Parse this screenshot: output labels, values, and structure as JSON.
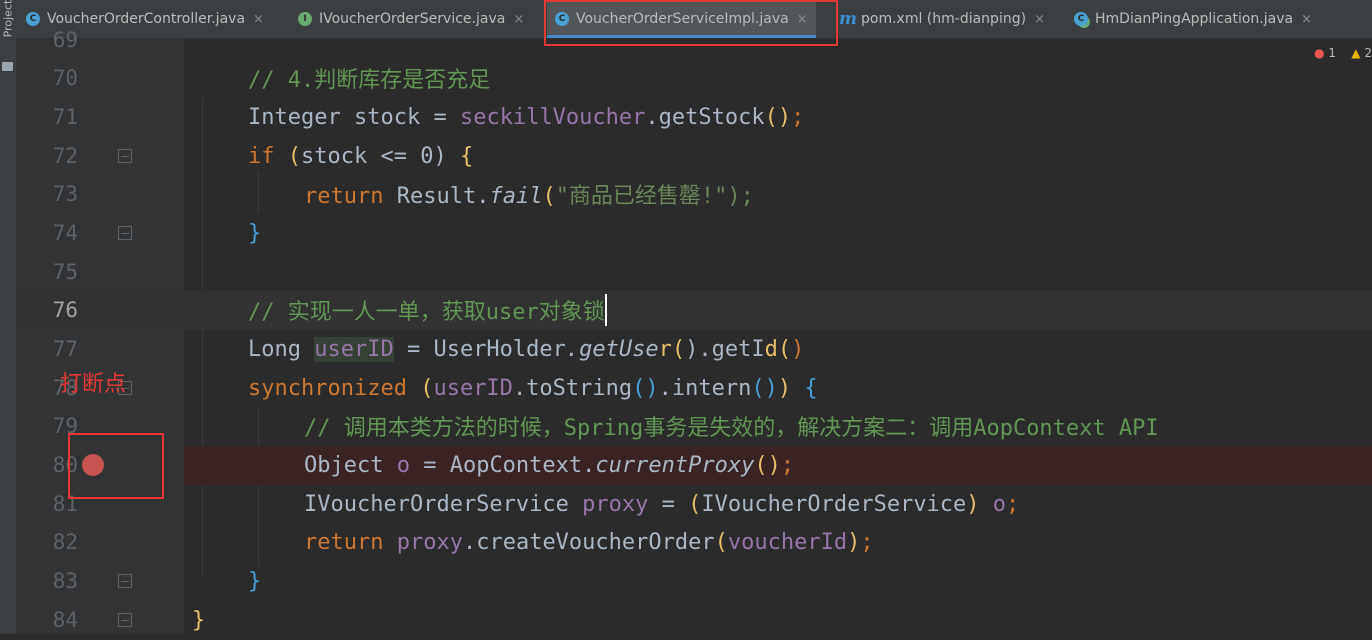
{
  "tabs": [
    {
      "label": "VoucherOrderController.java",
      "icon": "class-icon",
      "active": false
    },
    {
      "label": "IVoucherOrderService.java",
      "icon": "interface-icon",
      "active": false
    },
    {
      "label": "VoucherOrderServiceImpl.java",
      "icon": "class-icon",
      "active": true
    },
    {
      "label": "pom.xml (hm-dianping)",
      "icon": "maven-icon",
      "active": false
    },
    {
      "label": "HmDianPingApplication.java",
      "icon": "app-class-icon",
      "active": false
    }
  ],
  "close_glyph": "×",
  "side_panel": {
    "label": "Project"
  },
  "status": {
    "errors": "1",
    "warnings": "2"
  },
  "annotation": {
    "label": "打断点",
    "color": "#e53935"
  },
  "lines": [
    {
      "n": "69",
      "code": ""
    },
    {
      "n": "70",
      "code": "// 4.判断库存是否充足"
    },
    {
      "n": "71",
      "code": "Integer stock = seckillVoucher.getStock();"
    },
    {
      "n": "72",
      "code": "if (stock <= 0) {"
    },
    {
      "n": "73",
      "code": "return Result.fail(\"商品已经售罄!\");"
    },
    {
      "n": "74",
      "code": "}"
    },
    {
      "n": "75",
      "code": ""
    },
    {
      "n": "76",
      "code": "// 实现一人一单，获取user对象锁"
    },
    {
      "n": "77",
      "code": "Long userID = UserHolder.getUser().getId();"
    },
    {
      "n": "78",
      "code": "synchronized (userID.toString().intern()) {"
    },
    {
      "n": "79",
      "code": "// 调用本类方法的时候，Spring事务是失效的，解决方案二：调用AopContext API"
    },
    {
      "n": "80",
      "code": "Object o = AopContext.currentProxy();"
    },
    {
      "n": "81",
      "code": "IVoucherOrderService proxy = (IVoucherOrderService) o;"
    },
    {
      "n": "82",
      "code": "return proxy.createVoucherOrder(voucherId);"
    },
    {
      "n": "83",
      "code": "}"
    },
    {
      "n": "84",
      "code": "}"
    }
  ],
  "current_line": "76",
  "breakpoint_line": "80"
}
